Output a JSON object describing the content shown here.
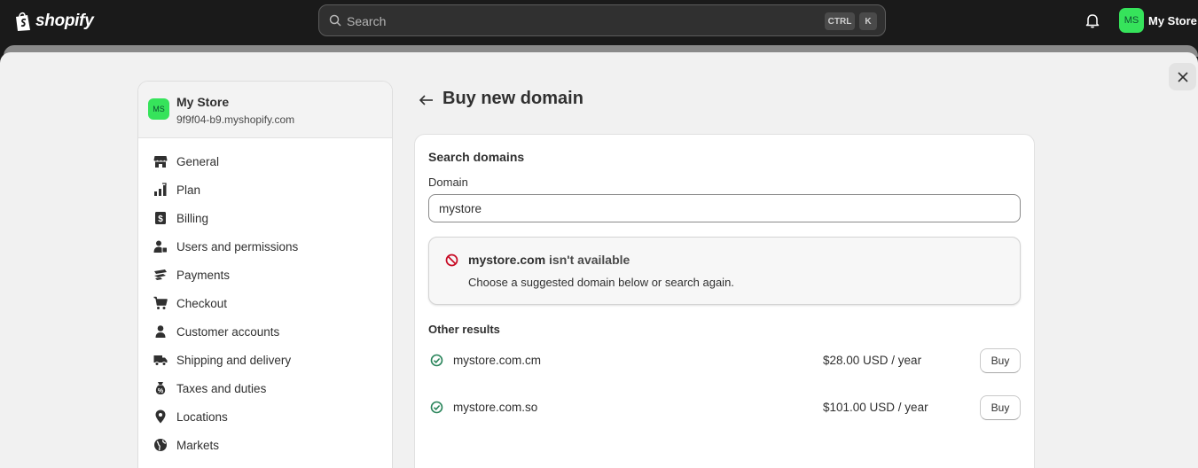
{
  "topbar": {
    "brand": "shopify",
    "search_placeholder": "Search",
    "shortcut_ctrl": "CTRL",
    "shortcut_key": "K",
    "avatar_initials": "MS",
    "store_name": "My Store"
  },
  "sidebar": {
    "store_initials": "MS",
    "store_name": "My Store",
    "store_domain": "9f9f04-b9.myshopify.com",
    "items": [
      {
        "label": "General",
        "icon": "store-icon"
      },
      {
        "label": "Plan",
        "icon": "plan-chart-icon"
      },
      {
        "label": "Billing",
        "icon": "billing-receipt-icon"
      },
      {
        "label": "Users and permissions",
        "icon": "users-icon"
      },
      {
        "label": "Payments",
        "icon": "payments-icon"
      },
      {
        "label": "Checkout",
        "icon": "cart-icon"
      },
      {
        "label": "Customer accounts",
        "icon": "person-icon"
      },
      {
        "label": "Shipping and delivery",
        "icon": "truck-icon"
      },
      {
        "label": "Taxes and duties",
        "icon": "money-bag-icon"
      },
      {
        "label": "Locations",
        "icon": "location-pin-icon"
      },
      {
        "label": "Markets",
        "icon": "globe-icon"
      }
    ]
  },
  "main": {
    "title": "Buy new domain",
    "card_title": "Search domains",
    "domain_label": "Domain",
    "domain_value": "mystore",
    "notice": {
      "domain": "mystore.com",
      "status": "isn't available",
      "message": "Choose a suggested domain below or search again."
    },
    "other_results_title": "Other results",
    "results": [
      {
        "domain": "mystore.com.cm",
        "price": "$28.00 USD / year",
        "action": "Buy"
      },
      {
        "domain": "mystore.com.so",
        "price": "$101.00 USD / year",
        "action": "Buy"
      }
    ]
  },
  "colors": {
    "topbar_bg": "#1a1a1a",
    "avatar_green": "#36e35b",
    "unavailable_red": "#c70a24",
    "available_green": "#29845a",
    "modal_bg": "#f1f1f1"
  }
}
